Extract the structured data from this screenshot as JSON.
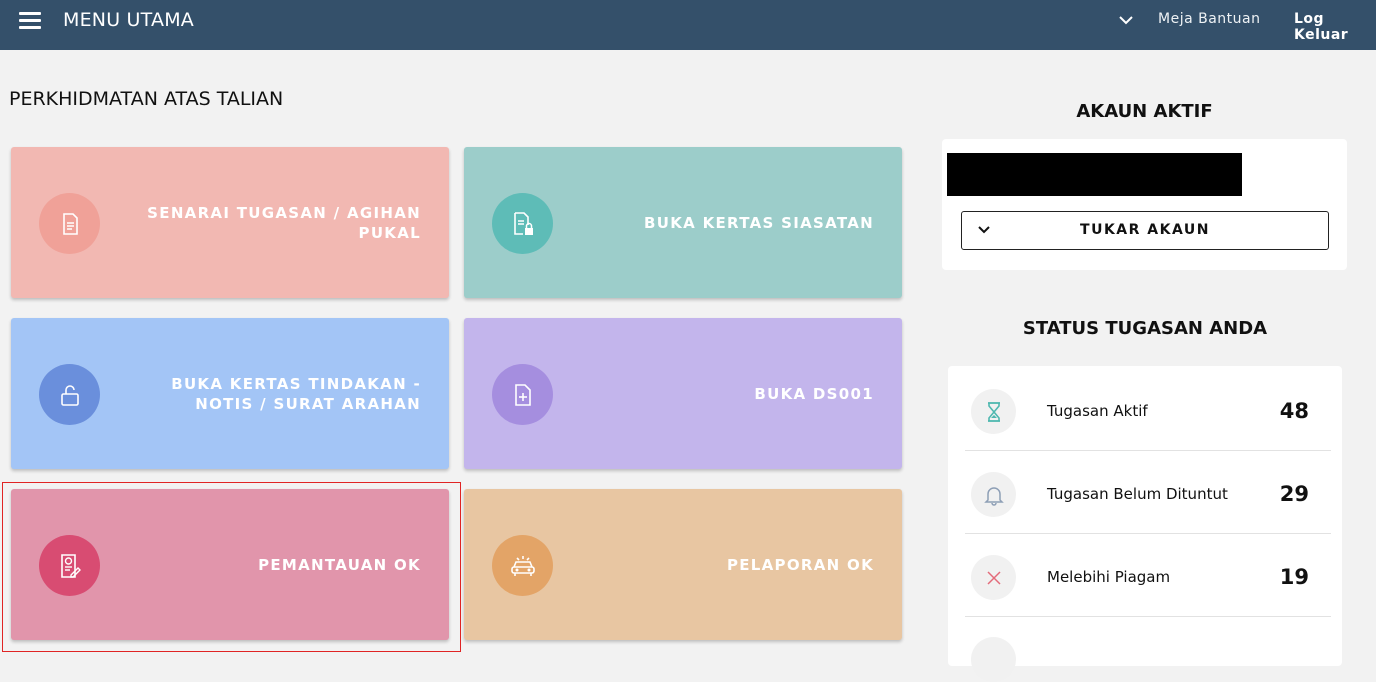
{
  "header": {
    "title": "MENU UTAMA",
    "help": "Meja Bantuan",
    "logout": "Log Keluar"
  },
  "main": {
    "section_title": "PERKHIDMATAN ATAS TALIAN",
    "tiles": [
      {
        "label": "SENARAI TUGASAN / AGIHAN PUKAL",
        "icon": "document-list-icon",
        "bg": "#f2b8b2",
        "circle": "#f0a198"
      },
      {
        "label": "BUKA KERTAS SIASATAN",
        "icon": "document-lock-icon",
        "bg": "#9ccdca",
        "circle": "#5ebcb7"
      },
      {
        "label": "BUKA KERTAS TINDAKAN - NOTIS / SURAT ARAHAN",
        "icon": "padlock-open-icon",
        "bg": "#a3c5f6",
        "circle": "#6a8fdc"
      },
      {
        "label": "BUKA DS001",
        "icon": "document-plus-icon",
        "bg": "#c3b5ec",
        "circle": "#a58edf"
      },
      {
        "label": "PEMANTAUAN OK",
        "icon": "monitoring-document-icon",
        "bg": "#e195ab",
        "circle": "#d84c72"
      },
      {
        "label": "PELAPORAN OK",
        "icon": "car-report-icon",
        "bg": "#e8c6a2",
        "circle": "#e3a467"
      }
    ]
  },
  "account": {
    "title": "AKAUN AKTIF",
    "switch_label": "TUKAR AKAUN"
  },
  "status": {
    "title": "STATUS TUGASAN ANDA",
    "rows": [
      {
        "label": "Tugasan Aktif",
        "count": "48",
        "icon": "hourglass-icon"
      },
      {
        "label": "Tugasan Belum Dituntut",
        "count": "29",
        "icon": "bell-icon"
      },
      {
        "label": "Melebihi Piagam",
        "count": "19",
        "icon": "close-icon"
      }
    ]
  }
}
